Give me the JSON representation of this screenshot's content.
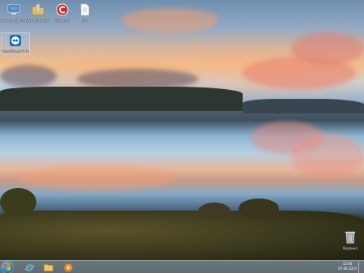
{
  "desktop": {
    "icons": [
      {
        "name": "computer-icon",
        "label": "Мой компьютер"
      },
      {
        "name": "folder-icon",
        "label": "WPI_MINIMAL"
      },
      {
        "name": "ccleaner-icon",
        "label": "CCleaner"
      },
      {
        "name": "text-file-icon",
        "label": "Info"
      },
      {
        "name": "teamviewer-icon",
        "label": "TeamViewer 8 Host"
      }
    ],
    "recycle_bin": {
      "label": "Корзина"
    }
  },
  "taskbar": {
    "pinned": [
      {
        "name": "internet-explorer-icon"
      },
      {
        "name": "explorer-icon"
      },
      {
        "name": "media-player-icon"
      }
    ],
    "clock": {
      "time": "12:00",
      "date": "07.08.2014"
    }
  },
  "colors": {
    "taskbar": "#8ea4ba",
    "start_orb": "#2a7dc3"
  }
}
